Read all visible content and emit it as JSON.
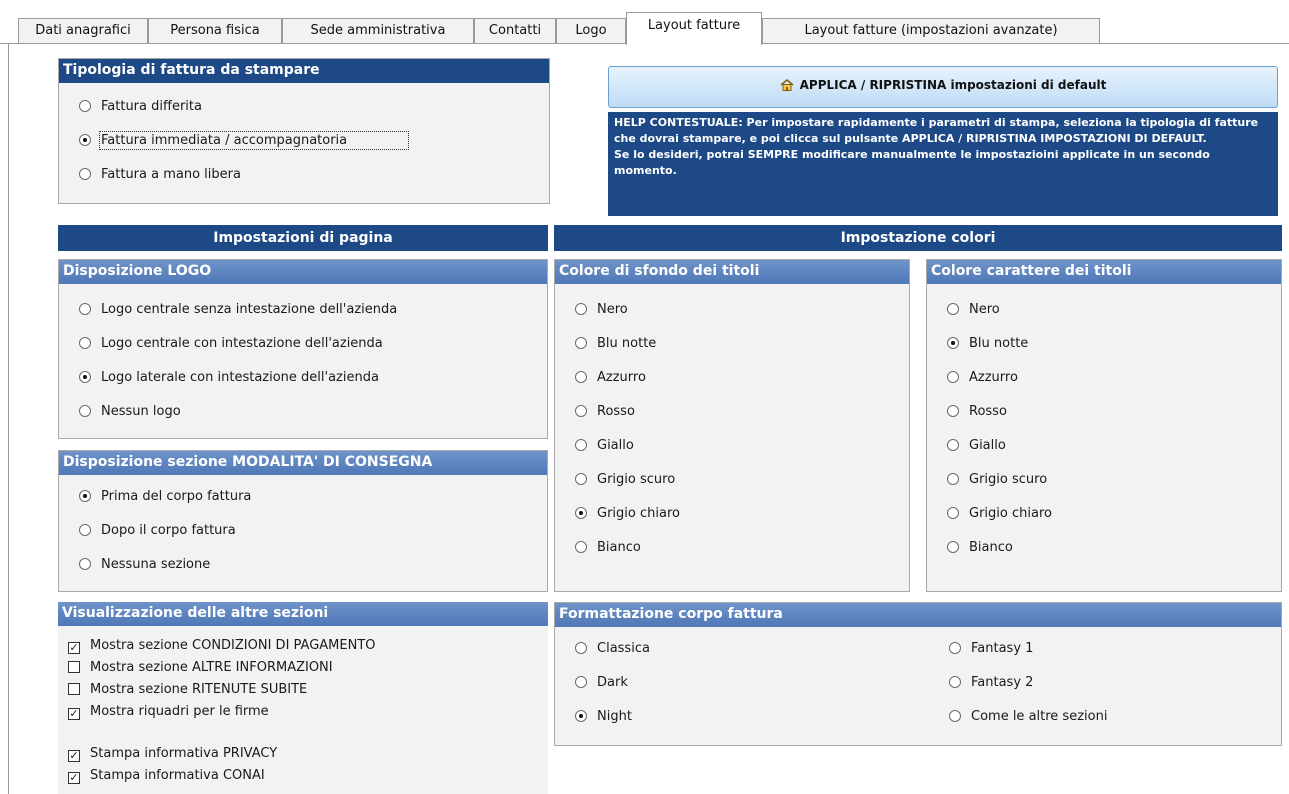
{
  "tabs": [
    {
      "label": "Dati anagrafici"
    },
    {
      "label": "Persona fisica"
    },
    {
      "label": "Sede amministrativa"
    },
    {
      "label": "Contatti"
    },
    {
      "label": "Logo"
    },
    {
      "label": "Layout fatture"
    },
    {
      "label": "Layout fatture (impostazioni avanzate)"
    }
  ],
  "active_tab": "Layout fatture",
  "tipologia": {
    "title": "Tipologia di fattura da stampare",
    "options": [
      "Fattura differita",
      "Fattura immediata / accompagnatoria",
      "Fattura a mano libera"
    ],
    "selected": "Fattura immediata / accompagnatoria"
  },
  "apply_button": {
    "label": "APPLICA / RIPRISTINA impostazioni di default",
    "icon": "home-icon"
  },
  "help": {
    "text1": "HELP CONTESTUALE: Per impostare rapidamente i parametri di stampa, seleziona la tipologia di fatture che dovrai stampare, e poi clicca sul pulsante APPLICA / RIPRISTINA IMPOSTAZIONI DI DEFAULT.",
    "text2": "Se lo desideri, potrai SEMPRE modificare manualmente le impostazioini applicate in un secondo momento."
  },
  "impostazioni_pagina": {
    "title": "Impostazioni di pagina"
  },
  "impostazione_colori": {
    "title": "Impostazione colori"
  },
  "disposizione_logo": {
    "title": "Disposizione LOGO",
    "options": [
      "Logo centrale senza intestazione dell'azienda",
      "Logo centrale con intestazione dell'azienda",
      "Logo laterale con intestazione dell'azienda",
      "Nessun logo"
    ],
    "selected": "Logo laterale con intestazione dell'azienda"
  },
  "modalita_consegna": {
    "title": "Disposizione sezione MODALITA' DI CONSEGNA",
    "options": [
      "Prima del corpo fattura",
      "Dopo il corpo fattura",
      "Nessuna sezione"
    ],
    "selected": "Prima del corpo fattura"
  },
  "colore_sfondo": {
    "title": "Colore di sfondo dei titoli",
    "options": [
      "Nero",
      "Blu notte",
      "Azzurro",
      "Rosso",
      "Giallo",
      "Grigio scuro",
      "Grigio chiaro",
      "Bianco"
    ],
    "selected": "Grigio chiaro"
  },
  "colore_carattere": {
    "title": "Colore carattere dei titoli",
    "options": [
      "Nero",
      "Blu notte",
      "Azzurro",
      "Rosso",
      "Giallo",
      "Grigio scuro",
      "Grigio chiaro",
      "Bianco"
    ],
    "selected": "Blu notte"
  },
  "altre_sezioni": {
    "title": "Visualizzazione delle altre sezioni",
    "checks": [
      {
        "label": "Mostra sezione CONDIZIONI DI PAGAMENTO",
        "checked": true
      },
      {
        "label": "Mostra sezione ALTRE INFORMAZIONI",
        "checked": false
      },
      {
        "label": "Mostra sezione RITENUTE SUBITE",
        "checked": false
      },
      {
        "label": "Mostra riquadri per le firme",
        "checked": true
      },
      {
        "label": "Stampa informativa PRIVACY",
        "checked": true
      },
      {
        "label": "Stampa informativa CONAI",
        "checked": true
      }
    ]
  },
  "formattazione": {
    "title": "Formattazione corpo fattura",
    "options": [
      "Classica",
      "Dark",
      "Night",
      "Fantasy 1",
      "Fantasy 2",
      "Come le altre sezioni"
    ],
    "selected": "Night"
  },
  "colors": {
    "header_dark": "#1d4a86",
    "header_mid": "#5a80bc",
    "panel": "#f2f2f2"
  }
}
